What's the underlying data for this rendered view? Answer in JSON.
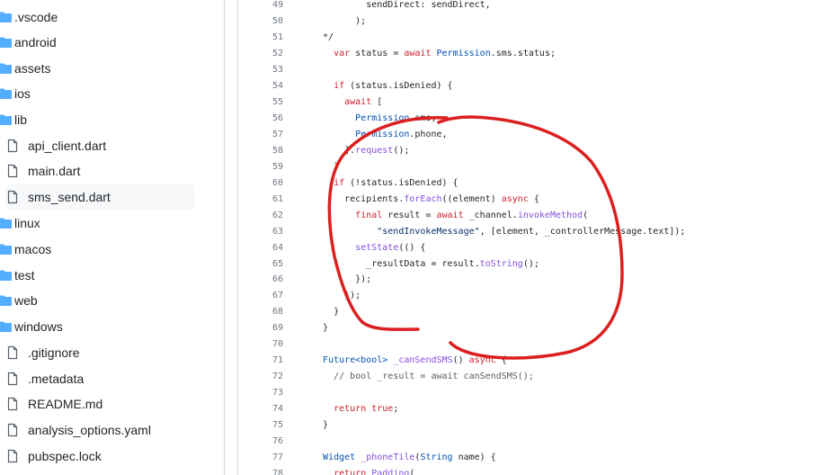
{
  "file_tree": {
    "items": [
      {
        "label": ".vscode",
        "type": "folder"
      },
      {
        "label": "android",
        "type": "folder"
      },
      {
        "label": "assets",
        "type": "folder"
      },
      {
        "label": "ios",
        "type": "folder"
      },
      {
        "label": "lib",
        "type": "folder-open"
      },
      {
        "label": "api_client.dart",
        "type": "file"
      },
      {
        "label": "main.dart",
        "type": "file"
      },
      {
        "label": "sms_send.dart",
        "type": "file",
        "selected": true
      },
      {
        "label": "linux",
        "type": "folder"
      },
      {
        "label": "macos",
        "type": "folder"
      },
      {
        "label": "test",
        "type": "folder"
      },
      {
        "label": "web",
        "type": "folder"
      },
      {
        "label": "windows",
        "type": "folder"
      },
      {
        "label": ".gitignore",
        "type": "file"
      },
      {
        "label": ".metadata",
        "type": "file"
      },
      {
        "label": "README.md",
        "type": "file"
      },
      {
        "label": "analysis_options.yaml",
        "type": "file"
      },
      {
        "label": "pubspec.lock",
        "type": "file"
      }
    ]
  },
  "code": {
    "lines": [
      {
        "n": "49",
        "t": "          sendDirect: sendDirect,"
      },
      {
        "n": "50",
        "t": "        );"
      },
      {
        "n": "51",
        "t": "  */"
      },
      {
        "n": "52",
        "t": "    var status = await Permission.sms.status;"
      },
      {
        "n": "53",
        "t": ""
      },
      {
        "n": "54",
        "t": "    if (status.isDenied) {"
      },
      {
        "n": "55",
        "t": "      await ["
      },
      {
        "n": "56",
        "t": "        Permission.sms,"
      },
      {
        "n": "57",
        "t": "        Permission.phone,"
      },
      {
        "n": "58",
        "t": "      ].request();"
      },
      {
        "n": "59",
        "t": "    }"
      },
      {
        "n": "60",
        "t": "    if (!status.isDenied) {"
      },
      {
        "n": "61",
        "t": "      recipients.forEach((element) async {"
      },
      {
        "n": "62",
        "t": "        final result = await _channel.invokeMethod("
      },
      {
        "n": "63",
        "t": "            \"sendInvokeMessage\", [element, _controllerMessage.text]);"
      },
      {
        "n": "64",
        "t": "        setState(() {"
      },
      {
        "n": "65",
        "t": "          _resultData = result.toString();"
      },
      {
        "n": "66",
        "t": "        });"
      },
      {
        "n": "67",
        "t": "      });"
      },
      {
        "n": "68",
        "t": "    }"
      },
      {
        "n": "69",
        "t": "  }"
      },
      {
        "n": "70",
        "t": ""
      },
      {
        "n": "71",
        "t": "  Future<bool> _canSendSMS() async {"
      },
      {
        "n": "72",
        "t": "    // bool _result = await canSendSMS();"
      },
      {
        "n": "73",
        "t": ""
      },
      {
        "n": "74",
        "t": "    return true;"
      },
      {
        "n": "75",
        "t": "  }"
      },
      {
        "n": "76",
        "t": ""
      },
      {
        "n": "77",
        "t": "  Widget _phoneTile(String name) {"
      },
      {
        "n": "78",
        "t": "    return Padding("
      }
    ]
  },
  "colors": {
    "folder_icon": "#54aeff",
    "annotation": "#dc1f1f",
    "selected_bg": "#f6f8fa"
  }
}
